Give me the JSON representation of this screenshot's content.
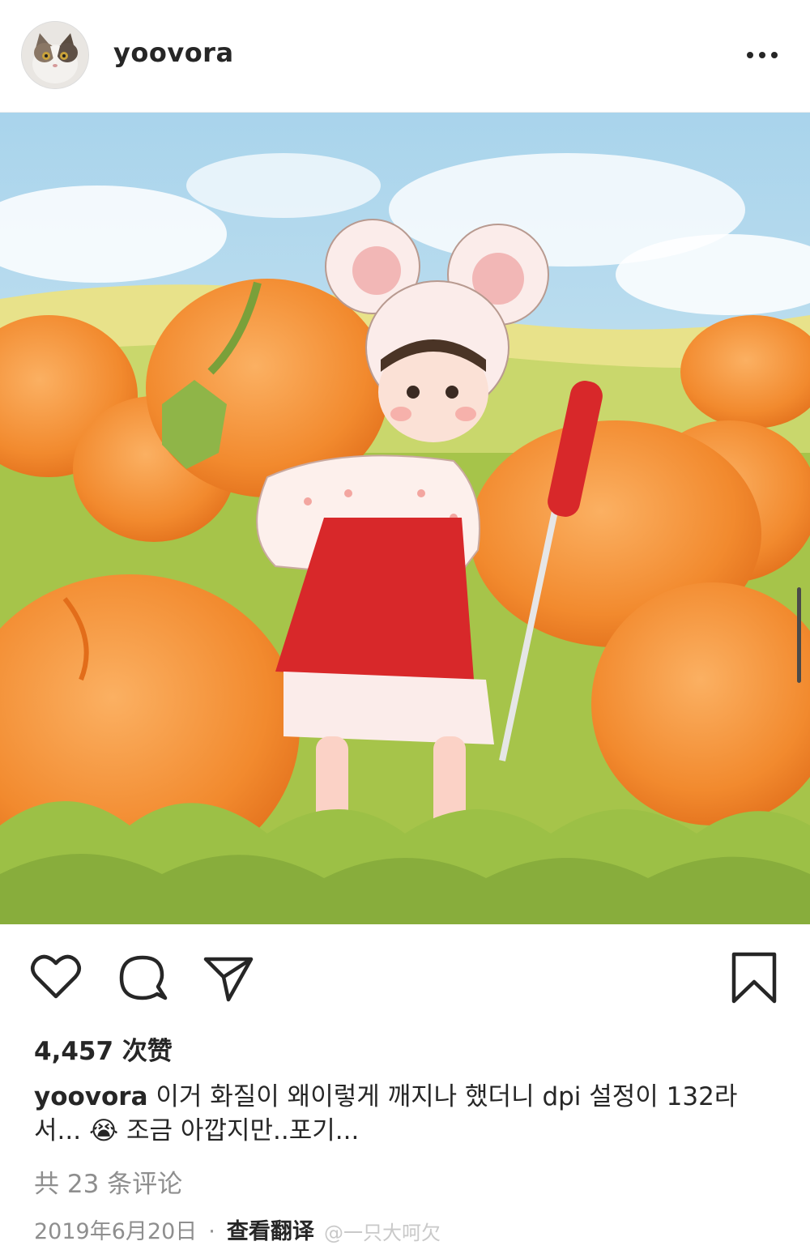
{
  "header": {
    "username": "yoovora"
  },
  "post": {
    "likes": "4,457 次赞",
    "caption_user": "yoovora",
    "caption_text": " 이거 화질이 왜이렇게 깨지나 했더니 dpi 설정이 132라서...",
    "caption_emoji": "😭",
    "caption_text2": " 조금 아깝지만..포기...",
    "comments": "共 23 条评论",
    "date": "2019年6月20日",
    "separator": "·",
    "translate": "查看翻译"
  },
  "watermark": "@一只大呵欠",
  "icons": {
    "like": "heart-icon",
    "comment": "comment-icon",
    "share": "send-icon",
    "save": "bookmark-icon",
    "more": "more-icon"
  },
  "colors": {
    "text": "#262626",
    "secondary": "#8e8e8e",
    "pumpkin": "#f08a2c",
    "dress": "#d8282a"
  }
}
